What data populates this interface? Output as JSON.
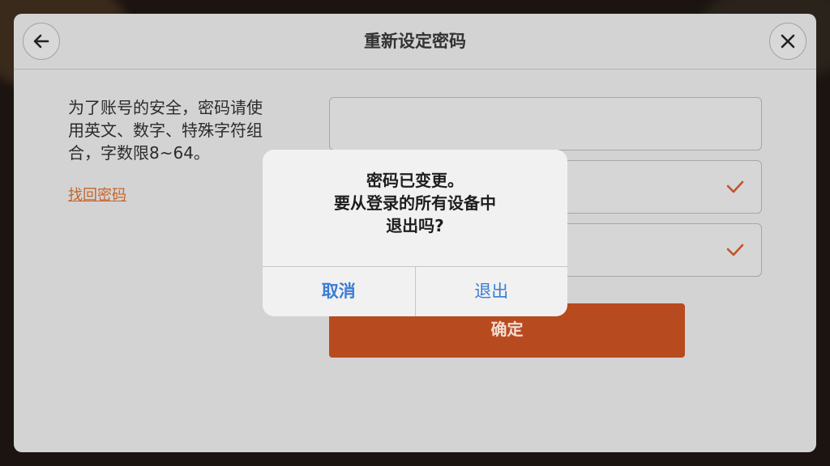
{
  "header": {
    "title": "重新设定密码",
    "back_icon": "arrow-left-icon",
    "close_icon": "close-icon"
  },
  "form": {
    "description": "为了账号的安全，密码请使用英文、数字、特殊字符组合，字数限8~64。",
    "description_lines": [
      "为了账号的安全，密码请使",
      "用英文、数字、特殊字符组",
      "合，字数限8~64。"
    ],
    "forgot_link": "找回密码",
    "confirm_label": "确定",
    "field2_status_icon": "check-icon",
    "field3_status_icon": "check-icon"
  },
  "dialog": {
    "message_lines": [
      "密码已变更。",
      "要从登录的所有设备中",
      "退出吗?"
    ],
    "cancel_label": "取消",
    "logout_label": "退出"
  },
  "colors": {
    "accent": "#b84a1f",
    "link": "#c8642a",
    "dialog_action": "#3b7cd6"
  }
}
